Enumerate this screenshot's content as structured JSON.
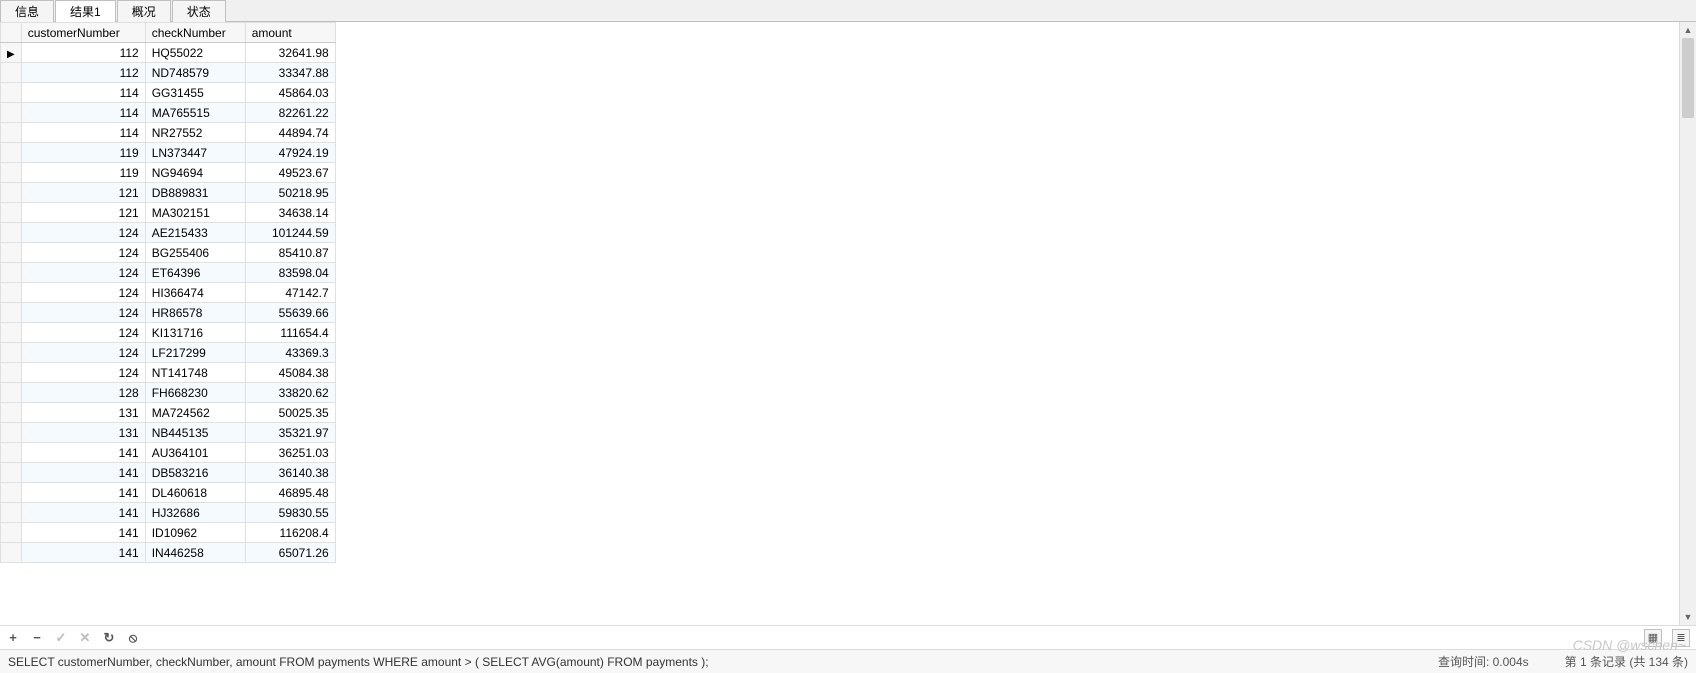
{
  "tabs": [
    {
      "label": "信息",
      "active": false
    },
    {
      "label": "结果1",
      "active": true
    },
    {
      "label": "概况",
      "active": false
    },
    {
      "label": "状态",
      "active": false
    }
  ],
  "columns": {
    "customerNumber": "customerNumber",
    "checkNumber": "checkNumber",
    "amount": "amount"
  },
  "rows": [
    {
      "customerNumber": 112,
      "checkNumber": "HQ55022",
      "amount": "32641.98",
      "current": true
    },
    {
      "customerNumber": 112,
      "checkNumber": "ND748579",
      "amount": "33347.88"
    },
    {
      "customerNumber": 114,
      "checkNumber": "GG31455",
      "amount": "45864.03"
    },
    {
      "customerNumber": 114,
      "checkNumber": "MA765515",
      "amount": "82261.22"
    },
    {
      "customerNumber": 114,
      "checkNumber": "NR27552",
      "amount": "44894.74"
    },
    {
      "customerNumber": 119,
      "checkNumber": "LN373447",
      "amount": "47924.19"
    },
    {
      "customerNumber": 119,
      "checkNumber": "NG94694",
      "amount": "49523.67"
    },
    {
      "customerNumber": 121,
      "checkNumber": "DB889831",
      "amount": "50218.95"
    },
    {
      "customerNumber": 121,
      "checkNumber": "MA302151",
      "amount": "34638.14"
    },
    {
      "customerNumber": 124,
      "checkNumber": "AE215433",
      "amount": "101244.59"
    },
    {
      "customerNumber": 124,
      "checkNumber": "BG255406",
      "amount": "85410.87"
    },
    {
      "customerNumber": 124,
      "checkNumber": "ET64396",
      "amount": "83598.04"
    },
    {
      "customerNumber": 124,
      "checkNumber": "HI366474",
      "amount": "47142.7"
    },
    {
      "customerNumber": 124,
      "checkNumber": "HR86578",
      "amount": "55639.66"
    },
    {
      "customerNumber": 124,
      "checkNumber": "KI131716",
      "amount": "111654.4"
    },
    {
      "customerNumber": 124,
      "checkNumber": "LF217299",
      "amount": "43369.3"
    },
    {
      "customerNumber": 124,
      "checkNumber": "NT141748",
      "amount": "45084.38"
    },
    {
      "customerNumber": 128,
      "checkNumber": "FH668230",
      "amount": "33820.62"
    },
    {
      "customerNumber": 131,
      "checkNumber": "MA724562",
      "amount": "50025.35"
    },
    {
      "customerNumber": 131,
      "checkNumber": "NB445135",
      "amount": "35321.97"
    },
    {
      "customerNumber": 141,
      "checkNumber": "AU364101",
      "amount": "36251.03"
    },
    {
      "customerNumber": 141,
      "checkNumber": "DB583216",
      "amount": "36140.38"
    },
    {
      "customerNumber": 141,
      "checkNumber": "DL460618",
      "amount": "46895.48"
    },
    {
      "customerNumber": 141,
      "checkNumber": "HJ32686",
      "amount": "59830.55"
    },
    {
      "customerNumber": 141,
      "checkNumber": "ID10962",
      "amount": "116208.4"
    },
    {
      "customerNumber": 141,
      "checkNumber": "IN446258",
      "amount": "65071.26"
    }
  ],
  "toolbar": {
    "add": "+",
    "remove": "−",
    "check": "✓",
    "cancel": "✕",
    "refresh": "↻",
    "stop": "⦸",
    "gridIcon": "▦",
    "formIcon": "≣"
  },
  "status": {
    "sql": "SELECT customerNumber, checkNumber, amount FROM payments WHERE amount > (          SELECT AVG(amount)          FROM payments );",
    "queryTime": "查询时间: 0.004s",
    "recordInfo": "第 1 条记录 (共 134 条)"
  },
  "watermark": "CSDN @wschen~"
}
